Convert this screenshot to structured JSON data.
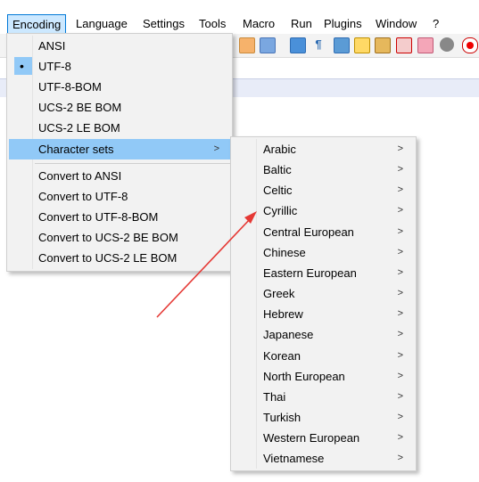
{
  "menubar": {
    "items": [
      "Encoding",
      "Language",
      "Settings",
      "Tools",
      "Macro",
      "Run",
      "Plugins",
      "Window",
      "?"
    ]
  },
  "encoding_menu": {
    "items": [
      "ANSI",
      "UTF-8",
      "UTF-8-BOM",
      "UCS-2 BE BOM",
      "UCS-2 LE BOM",
      "Character sets"
    ],
    "convert_items": [
      "Convert to ANSI",
      "Convert to UTF-8",
      "Convert to UTF-8-BOM",
      "Convert to UCS-2 BE BOM",
      "Convert to UCS-2 LE BOM"
    ],
    "selected": "UTF-8",
    "highlighted": "Character sets",
    "submenu_arrow": ">"
  },
  "charset_menu": {
    "items": [
      "Arabic",
      "Baltic",
      "Celtic",
      "Cyrillic",
      "Central European",
      "Chinese",
      "Eastern European",
      "Greek",
      "Hebrew",
      "Japanese",
      "Korean",
      "North European",
      "Thai",
      "Turkish",
      "Western European",
      "Vietnamese"
    ],
    "submenu_arrow": ">"
  },
  "colors": {
    "highlight": "#91c9f7",
    "menu_bg": "#f2f2f2",
    "annotation_arrow": "#e53935"
  }
}
